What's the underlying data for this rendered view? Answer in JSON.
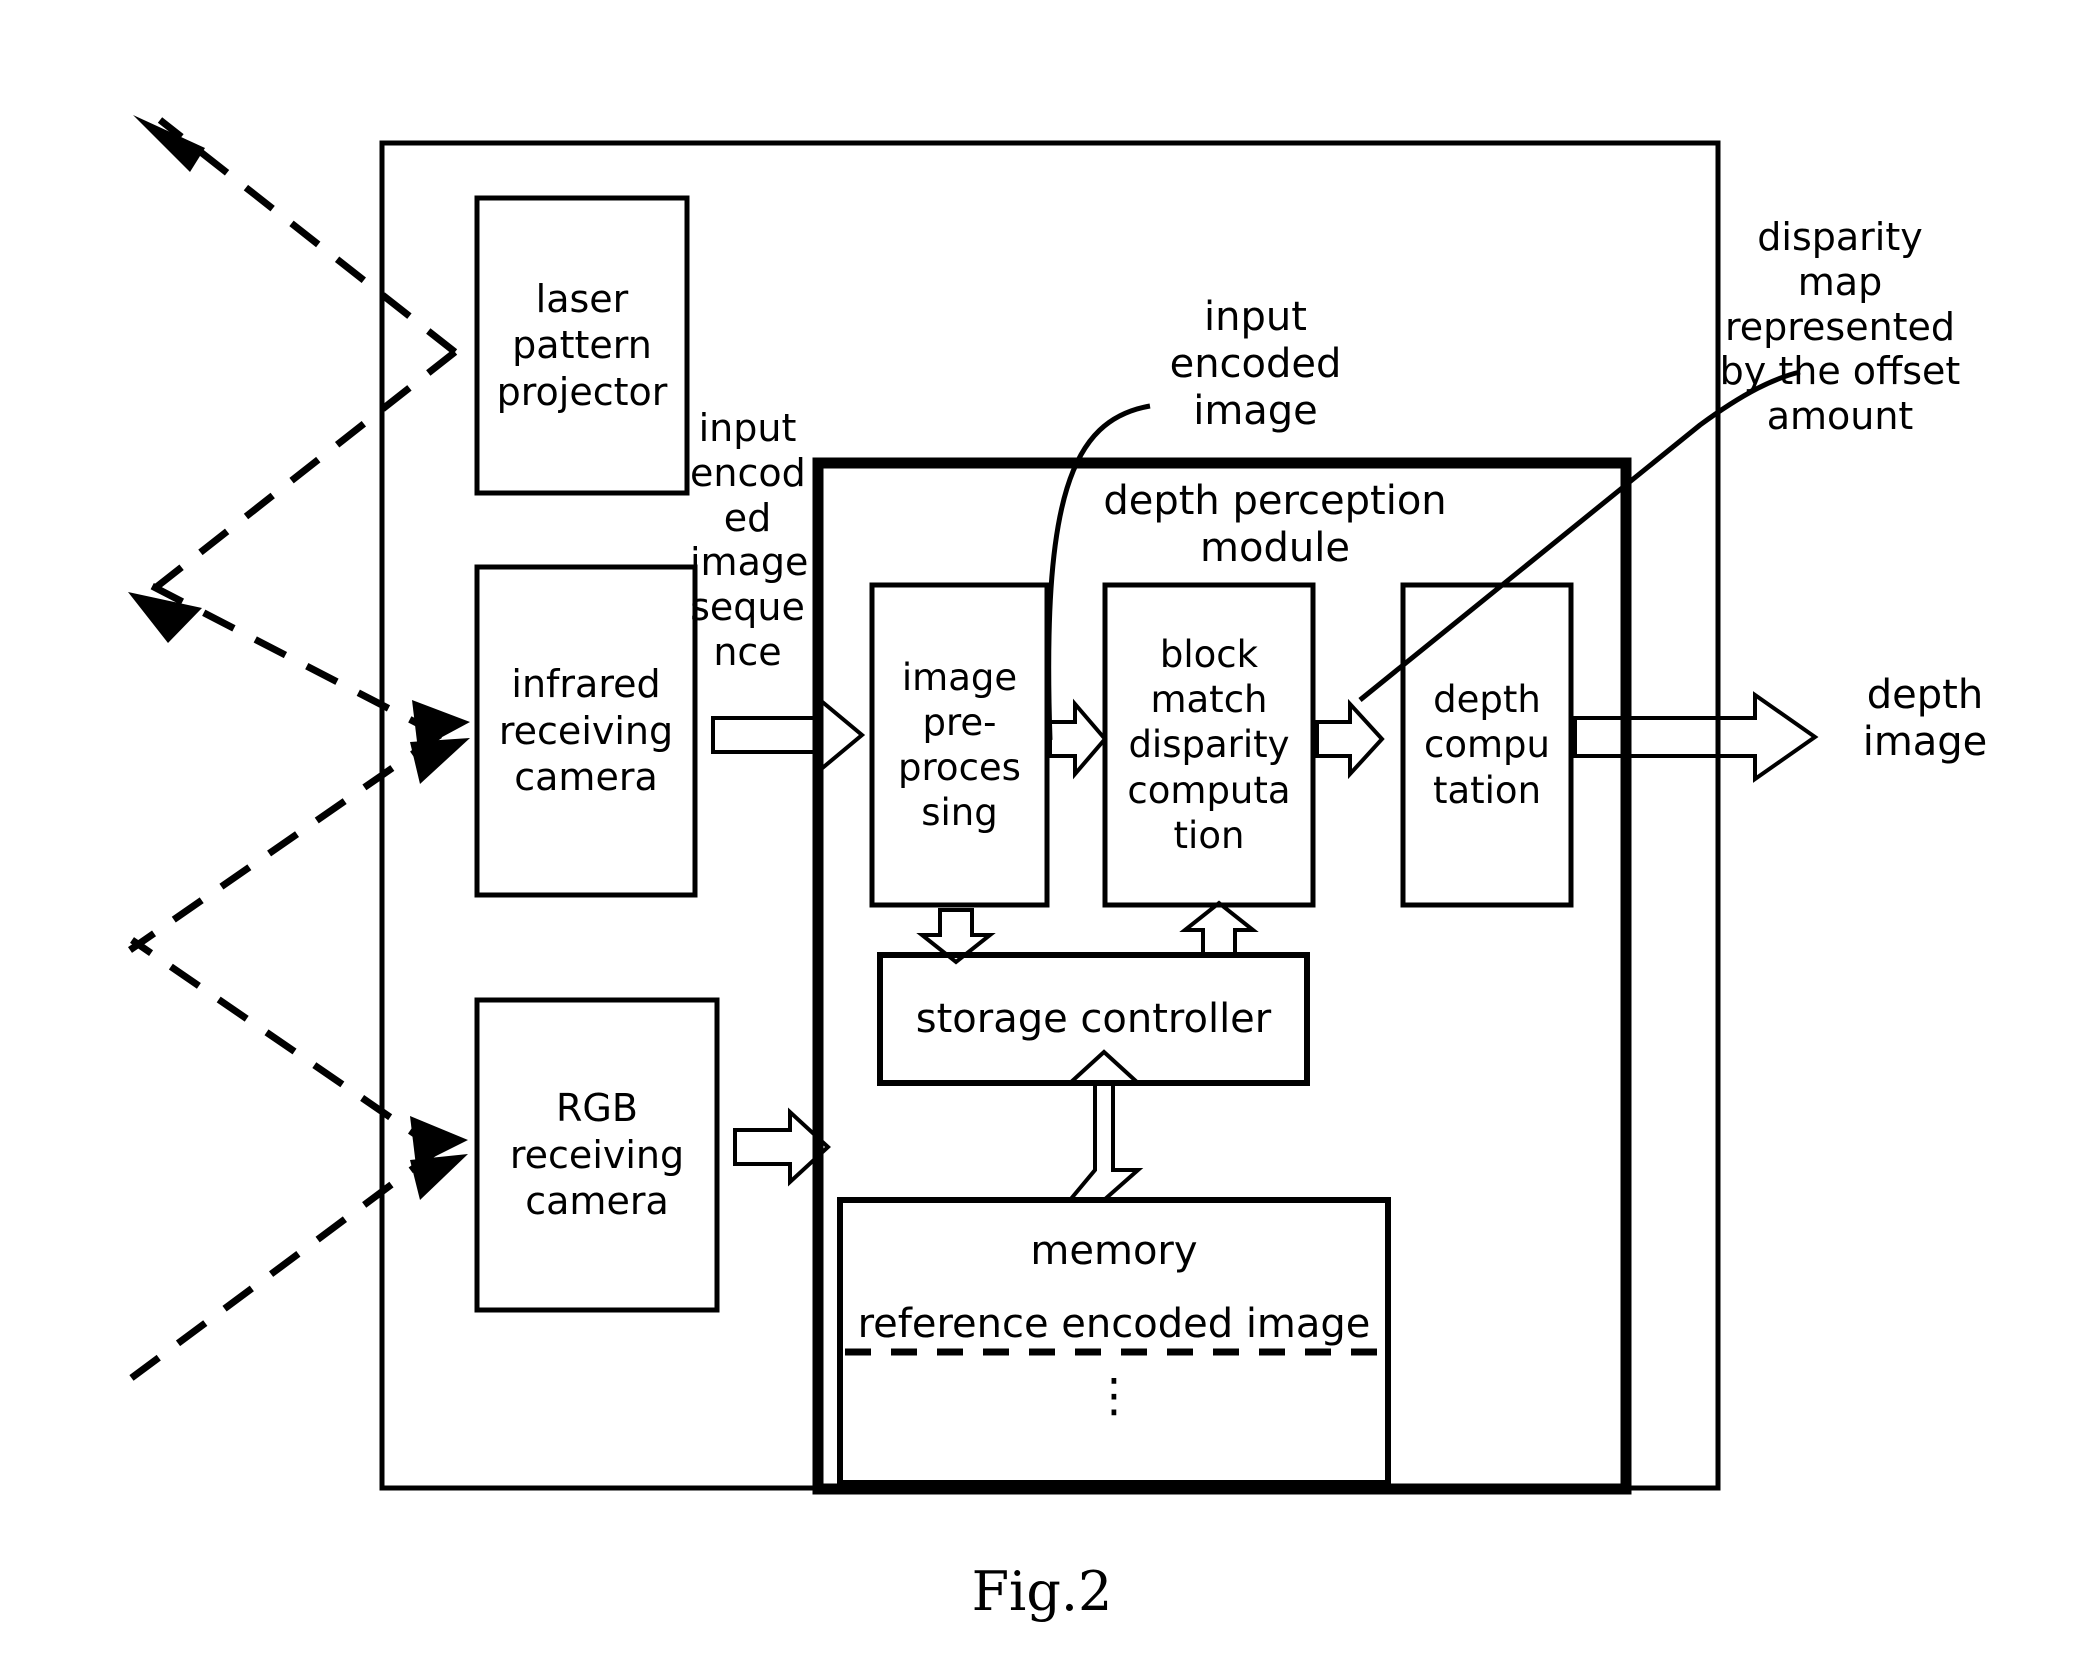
{
  "figure": {
    "caption": "Fig.2",
    "title": "depth perception module"
  },
  "boxes": {
    "laser_projector": "laser\npattern\nprojector",
    "infrared_camera": "infrared\nreceiving\ncamera",
    "rgb_camera": "RGB\nreceiving\ncamera",
    "image_preprocessing": "image\npre-\nproces\nsing",
    "block_match": "block\nmatch\ndisparity\ncomputa\ntion",
    "depth_computation": "depth\ncompu\ntation",
    "storage_controller": "storage controller",
    "memory_title": "memory",
    "memory_content": "reference encoded image",
    "memory_ellipsis": "⋮",
    "depth_perception_module": "depth perception\nmodule"
  },
  "labels": {
    "input_encoded_image_sequence": "input\nencod\ned\nimage\nseque\nnce",
    "input_encoded_image": "input\nencoded\nimage",
    "disparity_map": "disparity\nmap\nrepresented\nby the offset\namount",
    "depth_image": "depth\nimage"
  },
  "colors": {
    "stroke": "#000000",
    "background": "#ffffff"
  }
}
